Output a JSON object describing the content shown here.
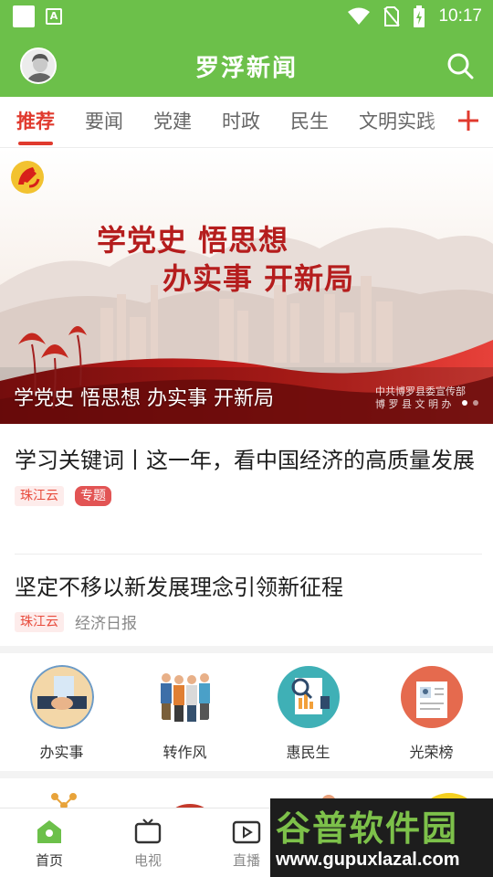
{
  "status_bar": {
    "time": "10:17",
    "a_badge": "A"
  },
  "header": {
    "title": "罗浮新闻"
  },
  "tabs": [
    {
      "label": "推荐",
      "active": true
    },
    {
      "label": "要闻"
    },
    {
      "label": "党建"
    },
    {
      "label": "时政"
    },
    {
      "label": "民生"
    },
    {
      "label": "文明实践"
    }
  ],
  "banner": {
    "caption": "学党史 悟思想 办实事 开新局",
    "slogan_line1": "学党史  悟思想",
    "slogan_line2": "办实事  开新局",
    "credit_line1": "中共博罗县委宣传部",
    "credit_line2": "博 罗 县 文 明 办"
  },
  "news": [
    {
      "title": "学习关键词丨这一年，看中国经济的高质量发展",
      "source_tag": "珠江云",
      "topic_tag": "专题"
    },
    {
      "title": "坚定不移以新发展理念引领新征程",
      "source_tag": "珠江云",
      "publisher": "经济日报"
    }
  ],
  "grid": [
    {
      "label": "办实事",
      "icon": "handshake-icon"
    },
    {
      "label": "转作风",
      "icon": "people-icon"
    },
    {
      "label": "惠民生",
      "icon": "report-icon"
    },
    {
      "label": "光荣榜",
      "icon": "honor-icon"
    }
  ],
  "bottom_nav": [
    {
      "label": "首页",
      "icon": "home-icon",
      "active": true
    },
    {
      "label": "电视",
      "icon": "tv-icon"
    },
    {
      "label": "直播",
      "icon": "live-icon"
    }
  ],
  "watermark": {
    "title": "谷普软件园",
    "url": "www.gupuxlazal.com"
  },
  "colors": {
    "brand_green": "#6cc04a",
    "accent_red": "#e03a2e",
    "tag_red": "#e25454"
  }
}
